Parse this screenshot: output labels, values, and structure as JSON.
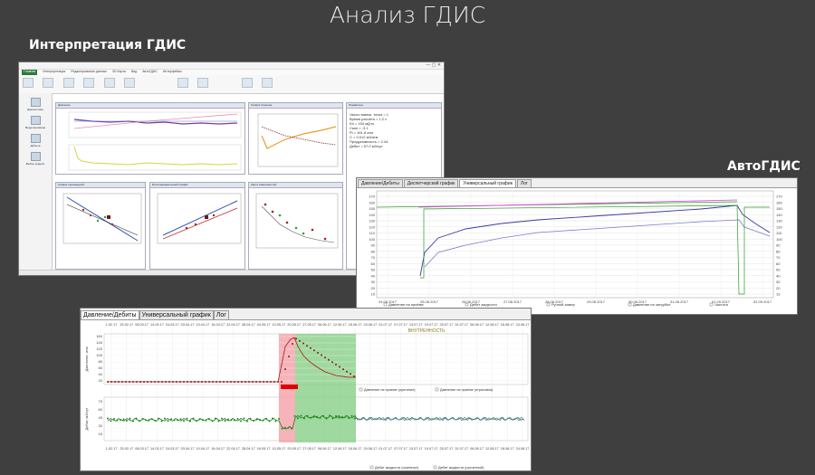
{
  "slide": {
    "title": "Анализ ГДИС",
    "caption_left": "Интерпретация ГДИС",
    "caption_right": "АвтоГДИС"
  },
  "window1": {
    "ribbon_tabs": [
      "Главная",
      "Интерпретация",
      "Редактирование данных",
      "3D Карта",
      "Вид",
      "АвтоГДИС",
      "Интерфейсы"
    ],
    "left_pane_items": [
      "Диагностика",
      "Моделирование",
      "Добыча",
      "Выбор модели"
    ],
    "panels": [
      "Давление",
      "График Хорнера",
      "Параметры",
      "График производной",
      "Билогарифмический график",
      "Карта зависимостей"
    ],
    "results_lines": [
      "Число взвеш. точек = 1",
      "Время расчёта = 1.2 с",
      "Kh = 154 мД·м",
      "Скин = -3.1",
      "Pi = 161.8 атм",
      "C = 0.012 м3/атм",
      "Продуктивность = 2.44",
      "Дебит = 57.0 м3/сут"
    ]
  },
  "window2": {
    "tabs": [
      "Давление/Дебиты",
      "Диспетчерский график",
      "Универсальный график",
      "Лог"
    ],
    "y_ticks": [
      "170",
      "160",
      "150",
      "140",
      "130",
      "120",
      "110",
      "100",
      "90",
      "80",
      "70",
      "60",
      "50",
      "40",
      "30",
      "20",
      "10"
    ],
    "x_ticks": [
      "24.08.2017",
      "25.08.2017",
      "26.08.2017",
      "27.08.2017",
      "28.08.2017",
      "29.08.2017",
      "30.08.2017",
      "31.08.2017",
      "01.09.2017",
      "02.09.2017"
    ],
    "legend": [
      "Давление на приёме",
      "Дебит жидкости",
      "Ручной замер",
      "Давление на затрубье",
      "Частота"
    ]
  },
  "window3": {
    "tabs": [
      "Давление/Дебиты",
      "Универсальный график",
      "Лог"
    ],
    "dates_top": [
      "1.02.17",
      "25.02.17",
      "08.03.17",
      "14.03.17",
      "24.03.17",
      "03.04.17",
      "10.04.17",
      "16.04.17",
      "22.04.17",
      "28.04.17",
      "04.05.17",
      "10.05.17",
      "20.05.17",
      "27.05.17",
      "06.06.17",
      "12.06.17",
      "18.06.17",
      "24.06.17",
      "01.07.17",
      "07.07.17",
      "13.07.17",
      "19.07.17",
      "25.07.17",
      "31.07.17",
      "06.08.17",
      "12.08.17",
      "18.08.17",
      "24.08.17"
    ],
    "banner": "ВНУТРЕННОСТЬ",
    "y1_label": "Давление, атм",
    "y1_ticks": [
      "160",
      "140",
      "120",
      "100",
      "80",
      "60",
      "40",
      "20"
    ],
    "y2_label": "Дебит, м3/сут",
    "y2_ticks": [
      "75",
      "60",
      "45",
      "30",
      "15"
    ],
    "legend_top": [
      "Давление на приеме (оригинал)",
      "Давление на приеме (отрисовка)"
    ],
    "legend_bottom": [
      "Дебит жидкости (оригинал)",
      "Дебит жидкости (расчетный)"
    ]
  }
}
